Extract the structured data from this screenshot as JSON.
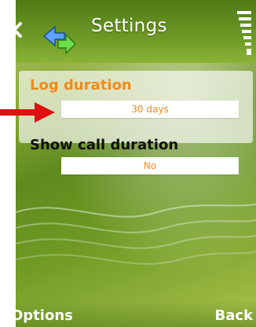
{
  "header": {
    "title": "Settings"
  },
  "settings": [
    {
      "label": "Log duration",
      "value": "30 days",
      "selected": true
    },
    {
      "label": "Show call duration",
      "value": "No",
      "selected": false
    }
  ],
  "softkeys": {
    "left": "Options",
    "right": "Back"
  },
  "colors": {
    "accent": "#f08a1a",
    "annotation_arrow": "#e01010"
  }
}
